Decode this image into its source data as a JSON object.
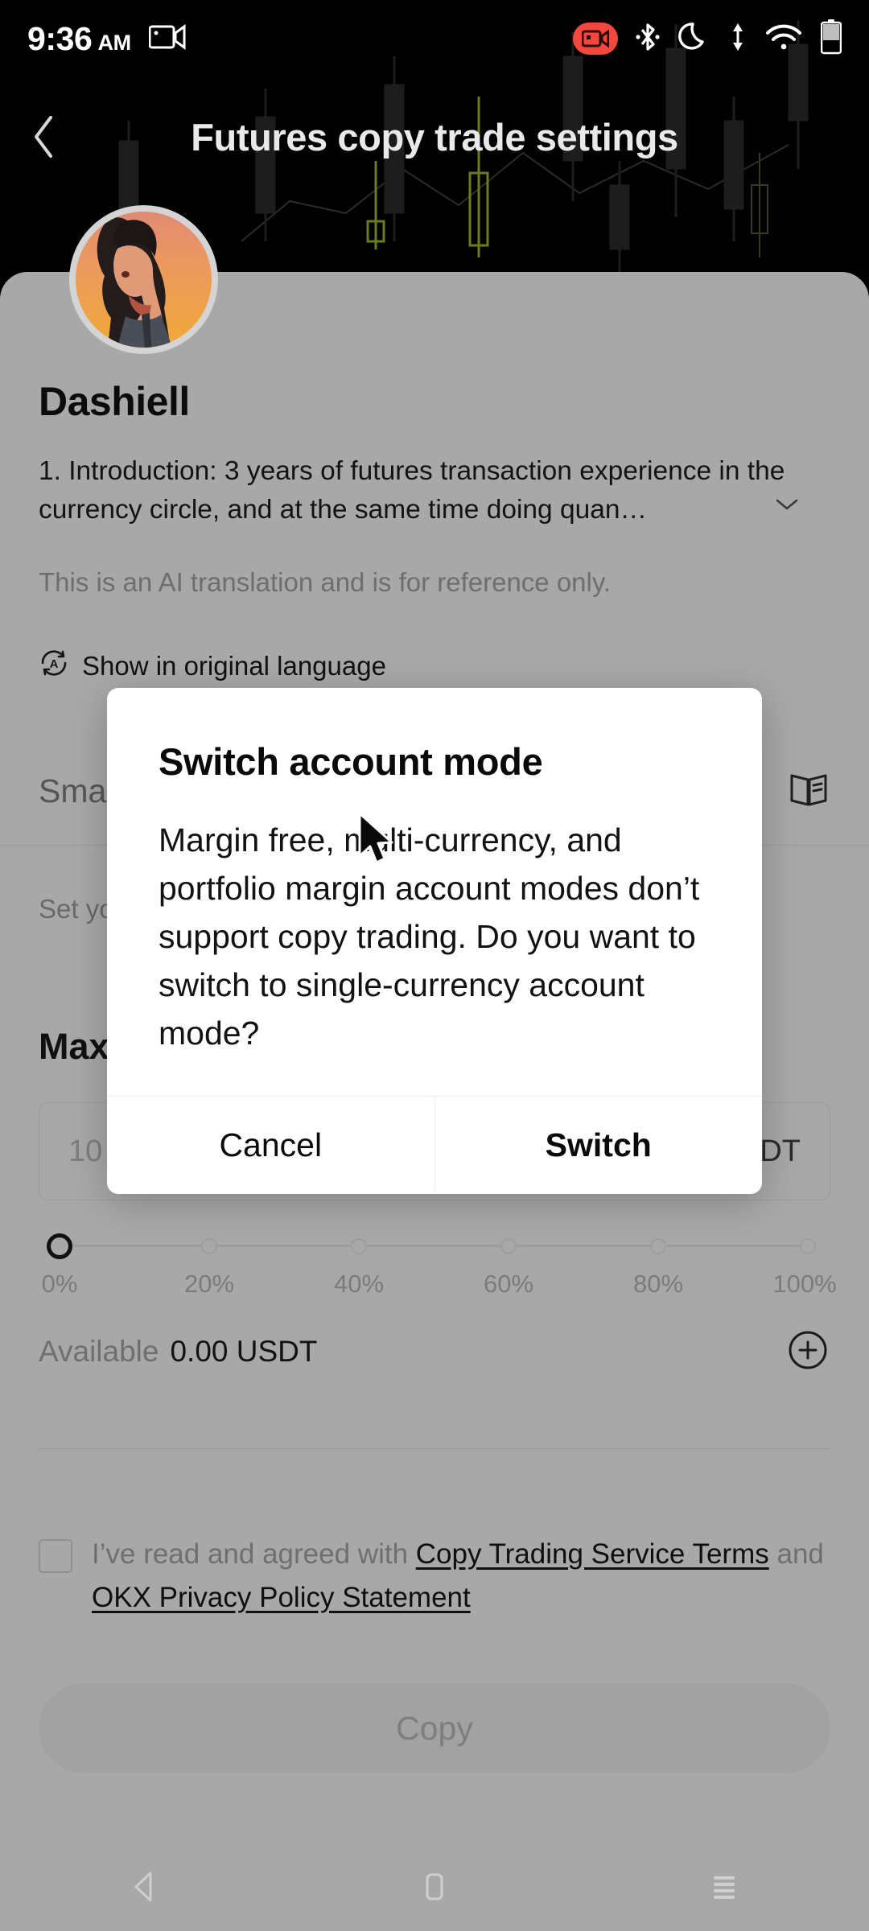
{
  "status_bar": {
    "time": "9:36",
    "ampm": "AM",
    "icons": [
      "screen-record-icon",
      "screen-record-badge-icon",
      "bluetooth-icon",
      "do-not-disturb-moon-icon",
      "data-transfer-icon",
      "wifi-icon",
      "battery-icon"
    ],
    "record_badge_color": "#f4483e"
  },
  "app_bar": {
    "back_label": "‹",
    "title": "Futures copy trade settings"
  },
  "profile": {
    "name": "Dashiell",
    "intro": "1. Introduction: 3 years of futures transaction experience in the currency circle, and at the same time doing quan…",
    "expand_icon": "chevron-down-icon",
    "ai_note": "This is an AI translation and is for reference only.",
    "original_language_label": "Show in original language",
    "translate_icon": "translate-icon"
  },
  "settings": {
    "smart_copy_label": "Smart copy",
    "guide_icon": "open-book-icon",
    "description": "Set your copy trade amount and leverage mode. Take ...",
    "max_label": "Max",
    "amount_placeholder": "10",
    "amount_unit": "USDT",
    "slider": {
      "value_percent": 0,
      "ticks": [
        "0%",
        "20%",
        "40%",
        "60%",
        "80%",
        "100%"
      ]
    },
    "available_label": "Available",
    "available_value": "0.00 USDT",
    "add_funds_icon": "plus-circle-icon"
  },
  "terms": {
    "checked": false,
    "prefix": "I’ve read and agreed with ",
    "link1": "Copy Trading Service Terms",
    "conjunction": " and ",
    "link2": "OKX Privacy Policy Statement"
  },
  "cta": {
    "copy_label": "Copy",
    "enabled": false
  },
  "dialog": {
    "title": "Switch account mode",
    "message": "Margin free, multi-currency, and portfolio margin account modes don’t support copy trading. Do you want to switch to single-currency account mode?",
    "cancel_label": "Cancel",
    "confirm_label": "Switch"
  },
  "nav_bar": {
    "back_icon": "triangle-back-icon",
    "home_icon": "square-home-icon",
    "recents_icon": "menu-recents-icon"
  }
}
